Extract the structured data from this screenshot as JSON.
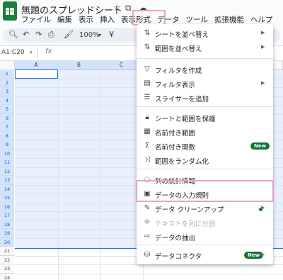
{
  "header": {
    "title": "無題のスプレッドシート",
    "menus": [
      "ファイル",
      "編集",
      "表示",
      "挿入",
      "表示形式",
      "データ",
      "ツール",
      "拡張機能",
      "ヘルプ"
    ]
  },
  "toolbar": {
    "zoom": "100%"
  },
  "formula_bar": {
    "cell_ref": "A1:C20",
    "fx": "fx"
  },
  "grid": {
    "columns": [
      "A",
      "B",
      "C"
    ],
    "rows": [
      "1",
      "2",
      "3",
      "4",
      "5",
      "6",
      "7",
      "8",
      "9",
      "10",
      "11",
      "12",
      "13",
      "14",
      "15",
      "16",
      "17",
      "18",
      "19",
      "20",
      "21",
      "22",
      "23",
      "24"
    ]
  },
  "data_menu": {
    "items": [
      {
        "label": "シートを並べ替え",
        "icon": "sort-icon",
        "submenu": true
      },
      {
        "label": "範囲を並べ替え",
        "icon": "sort-range-icon",
        "submenu": true
      },
      {
        "label": "フィルタを作成",
        "icon": "filter-icon"
      },
      {
        "label": "フィルタ表示",
        "icon": "filter-view-icon",
        "submenu": true
      },
      {
        "label": "スライサーを追加",
        "icon": "slicer-icon"
      },
      {
        "label": "シートと範囲を保護",
        "icon": "lock-icon"
      },
      {
        "label": "名前付き範囲",
        "icon": "named-range-icon"
      },
      {
        "label": "名前付き関数",
        "icon": "sigma-icon",
        "badge": "New"
      },
      {
        "label": "範囲をランダム化",
        "icon": "shuffle-icon"
      },
      {
        "label": "列の統計情報",
        "icon": "light-bulb-icon"
      },
      {
        "label": "データの入力規則",
        "icon": "validation-icon"
      },
      {
        "label": "データ クリーンアップ",
        "icon": "cleanup-icon",
        "submenu": true
      },
      {
        "label": "テキストを列に分割",
        "icon": "split-icon",
        "disabled": true
      },
      {
        "label": "データの抽出",
        "icon": "extract-icon"
      },
      {
        "label": "データコネクタ",
        "icon": "database-icon",
        "badge": "New",
        "submenu": true
      }
    ]
  },
  "colors": {
    "accent": "#1a73e8",
    "highlight": "#e8a4bd",
    "badge": "#137333"
  }
}
